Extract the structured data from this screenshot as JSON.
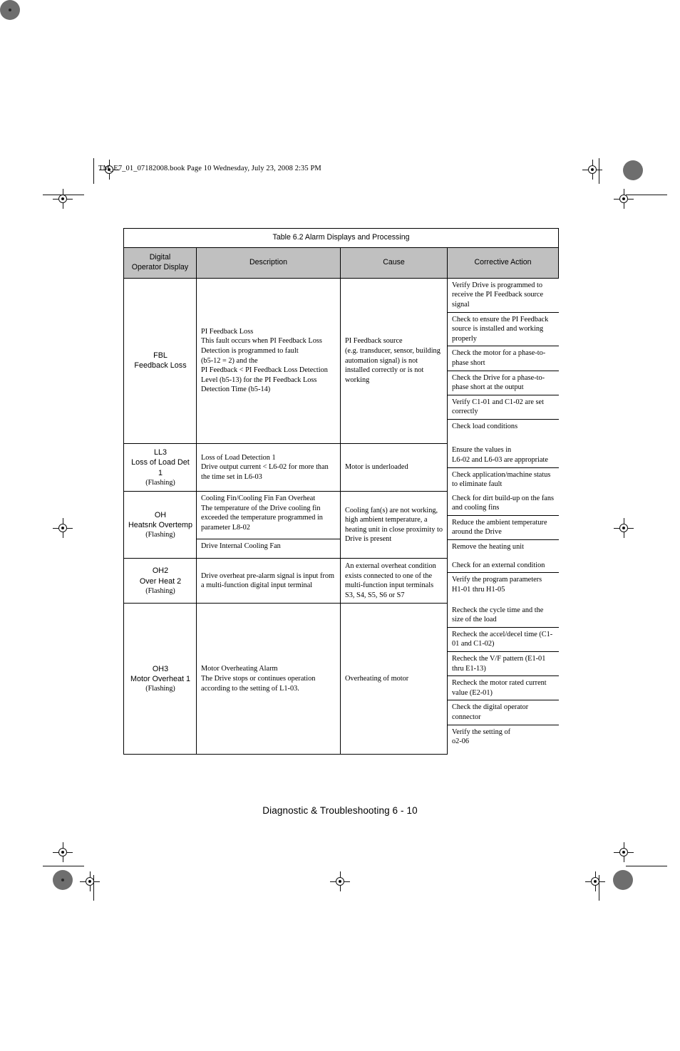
{
  "book_header": "TM_E7_01_07182008.book  Page 10  Wednesday, July 23, 2008  2:35 PM",
  "footer": "Diagnostic & Troubleshooting  6 - 10",
  "table": {
    "caption": "Table 6.2  Alarm Displays and Processing",
    "columns": [
      "Digital\nOperator Display",
      "Description",
      "Cause",
      "Corrective Action"
    ],
    "columns_flat": {
      "display": "Digital Operator Display",
      "display_line1": "Digital",
      "display_line2": "Operator Display",
      "description": "Description",
      "cause": "Cause",
      "corrective": "Corrective Action"
    },
    "rows": [
      {
        "code": "FBL",
        "name": "Feedback Loss",
        "flashing": "",
        "description": "PI Feedback Loss\nThis fault occurs when PI Feedback Loss Detection is programmed to fault\n(b5-12 = 2) and the\nPI Feedback < PI Feedback Loss Detection Level (b5-13) for the PI Feedback Loss Detection Time (b5-14)",
        "cause": "PI Feedback source\n(e.g. transducer, sensor, building automation signal) is not installed correctly or is not working",
        "actions": [
          "Verify Drive is programmed to receive the PI Feedback source signal",
          "Check to ensure the PI Feedback source is installed and working properly",
          "Check the motor for a phase-to-phase short",
          "Check the Drive for a phase-to-phase short at the output",
          "Verify C1-01 and C1-02 are set correctly",
          "Check load conditions"
        ]
      },
      {
        "code": "LL3",
        "name": "Loss of Load Det 1",
        "flashing": "(Flashing)",
        "description": "Loss of Load Detection 1\nDrive output current < L6-02 for more than the time set in L6-03",
        "cause": "Motor is underloaded",
        "actions": [
          "Ensure the values in\nL6-02 and L6-03 are appropriate",
          "Check application/machine status to eliminate fault"
        ]
      },
      {
        "code": "OH",
        "name": "Heatsnk Overtemp",
        "flashing": "(Flashing)",
        "description": "Cooling Fin/Cooling Fin Fan Overheat\nThe temperature of the Drive cooling fin exceeded the temperature programmed in parameter L8-02",
        "description_2": "Drive Internal Cooling Fan",
        "cause": "Cooling fan(s) are not working, high ambient temperature, a heating unit in close proximity to Drive is present",
        "actions": [
          "Check for dirt build-up on the fans and cooling fins",
          "Reduce the ambient temperature around the Drive",
          "Remove the heating unit"
        ]
      },
      {
        "code": "OH2",
        "name": "Over Heat 2",
        "flashing": "(Flashing)",
        "description": "Drive overheat pre-alarm signal is input from a multi-function digital input terminal",
        "cause": "An external overheat condition exists connected to one of the multi-function input terminals S3, S4, S5, S6 or S7",
        "actions": [
          "Check for an external condition",
          "Verify the program parameters H1-01 thru H1-05"
        ]
      },
      {
        "code": "OH3",
        "name": "Motor Overheat 1",
        "flashing": "(Flashing)",
        "description": "Motor Overheating Alarm\nThe Drive stops or continues operation according to the setting of L1-03.",
        "cause": "Overheating of motor",
        "actions": [
          "Recheck the cycle time and the size of the load",
          "Recheck the accel/decel time (C1-01 and C1-02)",
          "Recheck the V/F pattern (E1-01 thru E1-13)",
          "Recheck the motor rated current value (E2-01)",
          "Check the digital operator connector",
          "Verify the setting of\no2-06"
        ]
      }
    ]
  },
  "colors": {
    "header_fill": "#c0c0c0",
    "border": "#000000",
    "page_bg": "#ffffff"
  }
}
